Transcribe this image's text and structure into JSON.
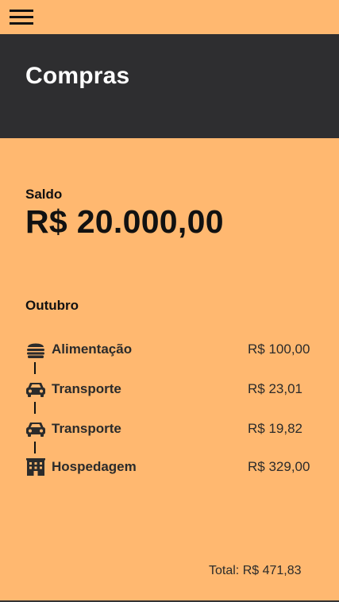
{
  "menu": {
    "icon": "hamburger-menu-icon"
  },
  "header": {
    "title": "Compras"
  },
  "balance": {
    "label": "Saldo",
    "value": "R$ 20.000,00"
  },
  "month": {
    "label": "Outubro"
  },
  "transactions": [
    {
      "icon": "burger-icon",
      "category": "Alimentação",
      "amount": "R$ 100,00"
    },
    {
      "icon": "car-icon",
      "category": "Transporte",
      "amount": "R$ 23,01"
    },
    {
      "icon": "car-icon",
      "category": "Transporte",
      "amount": "R$ 19,82"
    },
    {
      "icon": "building-icon",
      "category": "Hospedagem",
      "amount": "R$ 329,00"
    }
  ],
  "total": {
    "text": "Total: R$ 471,83"
  },
  "colors": {
    "background": "#ffb870",
    "header": "#2e2e30",
    "header_text": "#ffffff",
    "text": "#111111",
    "icon": "#2b2b2b"
  }
}
